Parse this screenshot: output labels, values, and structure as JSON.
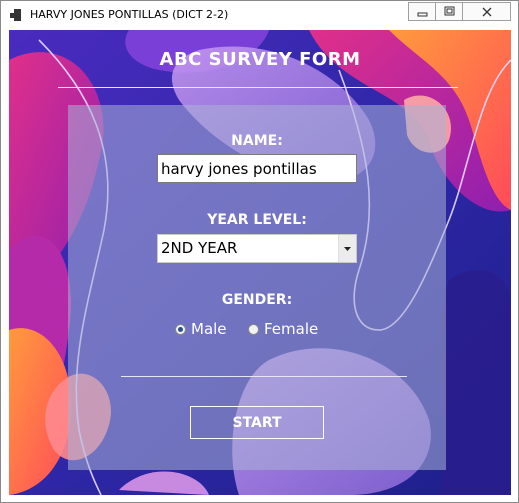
{
  "window": {
    "title": "HARVY JONES PONTILLAS (DICT 2-2)",
    "controls": {
      "minimize": "minimize",
      "maximize": "maximize",
      "close": "close"
    }
  },
  "form": {
    "heading": "ABC SURVEY FORM",
    "name_label": "NAME:",
    "name_value": "harvy jones pontillas",
    "year_label": "YEAR LEVEL:",
    "year_value": "2ND YEAR",
    "gender_label": "GENDER:",
    "gender_options": [
      {
        "label": "Male",
        "selected": true
      },
      {
        "label": "Female",
        "selected": false
      }
    ],
    "start_label": "START"
  },
  "colors": {
    "background_base": "#3b1fa0",
    "accent_orange": "#ff6a3a",
    "accent_magenta": "#d1288e",
    "text": "#ffffff"
  },
  "icons": [
    "app-icon",
    "minimize-icon",
    "maximize-icon",
    "close-icon",
    "dropdown-arrow-icon"
  ]
}
